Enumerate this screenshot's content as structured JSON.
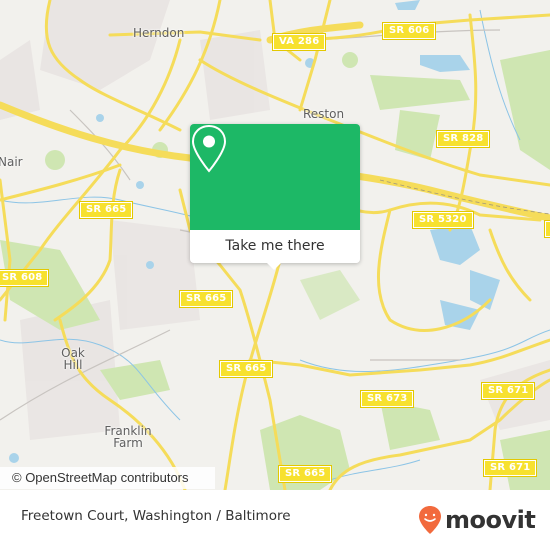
{
  "map": {
    "places": [
      {
        "name": "Herndon"
      },
      {
        "name": "Reston"
      },
      {
        "name": "Nair"
      },
      {
        "name": "Oak Hill"
      },
      {
        "name": "Franklin Farm"
      }
    ],
    "shields": [
      {
        "label": "VA 286"
      },
      {
        "label": "SR 606"
      },
      {
        "label": "SR 828"
      },
      {
        "label": "SR 665"
      },
      {
        "label": "SR 5320"
      },
      {
        "label": "SR 608"
      },
      {
        "label": "SR 665"
      },
      {
        "label": "SR 665"
      },
      {
        "label": "SR 673"
      },
      {
        "label": "SR 671"
      },
      {
        "label": "SR 671"
      },
      {
        "label": "SR 665"
      }
    ],
    "attribution": "© OpenStreetMap contributors"
  },
  "popup": {
    "button_label": "Take me there",
    "icon": "location-pin-icon",
    "color": "#1db866"
  },
  "footer": {
    "title": "Freetown Court, Washington / Baltimore",
    "brand": "moovit",
    "brand_color": "#f26a3d"
  }
}
